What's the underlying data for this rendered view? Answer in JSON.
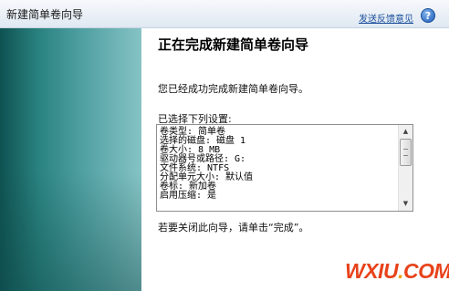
{
  "window": {
    "title": "新建简单卷向导",
    "feedback_link": "发送反馈意见",
    "help_glyph": "?"
  },
  "page": {
    "heading": "正在完成新建简单卷向导",
    "success_message": "您已经成功完成新建简单卷向导。",
    "settings_label": "已选择下列设置:",
    "summary_lines": [
      "卷类型: 简单卷",
      "选择的磁盘: 磁盘 1",
      "卷大小: 8 MB",
      "驱动器号或路径: G:",
      "文件系统: NTFS",
      "分配单元大小: 默认值",
      "卷标: 新加卷",
      "启用压缩: 是"
    ],
    "close_hint": "若要关闭此向导，请单击“完成”。"
  },
  "scrollbar": {
    "up_glyph": "▲",
    "down_glyph": "▼"
  },
  "watermark": {
    "part1": "WXIU",
    "part2": ".",
    "part3": "COM"
  },
  "colors": {
    "side_panel_dark": "#0f5252",
    "side_panel_light": "#86c3c5",
    "link": "#1a4f9c",
    "watermark_red": "#e8421a",
    "watermark_orange": "#f2a20a"
  }
}
